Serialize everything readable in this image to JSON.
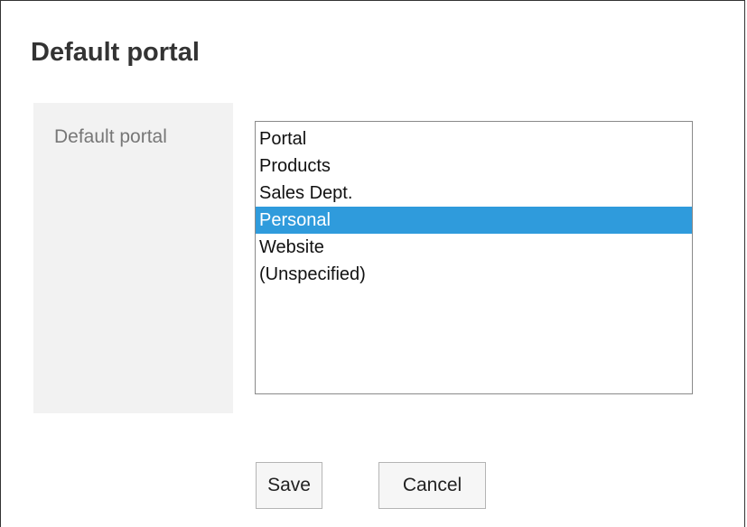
{
  "page": {
    "title": "Default portal"
  },
  "form": {
    "field_label": "Default portal",
    "listbox": {
      "options": [
        "Portal",
        "Products",
        "Sales Dept.",
        "Personal",
        "Website",
        "(Unspecified)"
      ],
      "selected_index": 3,
      "selected_value": "Personal"
    }
  },
  "buttons": {
    "save_label": "Save",
    "cancel_label": "Cancel"
  },
  "colors": {
    "selection": "#2f9bdc",
    "label_background": "#f2f2f2"
  }
}
